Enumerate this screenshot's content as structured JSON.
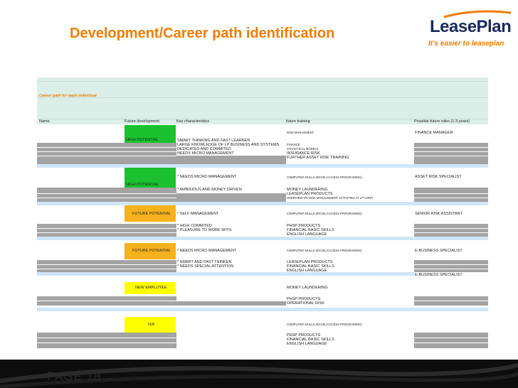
{
  "header": {
    "title": "Development/Career path identification",
    "logo_text": "LeasePlan",
    "tagline": "It's easier to leaseplan"
  },
  "table": {
    "section_title": "Career path for each individual",
    "columns": [
      "Name",
      "Future development",
      "Key characteristics",
      "future training",
      "Possible future roles (1-3 years)"
    ],
    "groups": [
      {
        "status": "HIGH POTENTIAL",
        "status_color": "#19c22e",
        "characteristics": [
          "SMART THINKING AND FAST LEARNER",
          "LARGE KNOWLEDGE OF LP BUSINESS AND SYSTEMS",
          "DEDICATED AND COMMITED",
          "NEEDS MICRO MANAGEMENT"
        ],
        "training": [
          "RISK MANAGMENT",
          "FINANCE",
          "STATISTICAL MODELS",
          "INSURANCE RISK",
          "FURTHER ASSET RISK TRAINING"
        ],
        "roles": [
          "FINANCE MANAGER"
        ]
      },
      {
        "status": "HIGH POTENCIAL",
        "status_color": "#19c22e",
        "characteristics": [
          "* NEEDS MICRO MANAGEMENT",
          "* AMBISIOUS AND MONEY DRIVEN"
        ],
        "training": [
          "COMPUTER SKILLS (EXCEL/ACCESS PROGRAMING)",
          "MONEY LAUNDERING",
          "LEASEPLAN  PRODUCTS",
          "OVERVIEW ON RISK MANAGEMENT ACTIVITIES AT LP CORP"
        ],
        "roles": [
          "ASSET RISK SPECIALIST"
        ]
      },
      {
        "status": "FUTURE POTENTIAL",
        "status_color": "#f5b21c",
        "characteristics": [
          "* SELF MANAGEMENT",
          "* HIGH COMMITED",
          "* PLEASURE TO WORK WITH"
        ],
        "training": [
          "COMPUTER SKILLS (EXCEL/ACCESS PROGRAMING)",
          "PHSP PRODUCTS",
          "FINANCIAL BASIC SKILLS",
          "ENGLISH LANGUAGE"
        ],
        "roles": [
          "SENIOR RISK ASSISTANT"
        ]
      },
      {
        "status": "FUTURE POTENTIAL",
        "status_color": "#f5b21c",
        "characteristics": [
          "* NEEDS MICRO MANAGEMENT",
          "* SMART AND FAST THINKEN",
          "* NEEDS SPECIAL ATTENTION"
        ],
        "training": [
          "COMPUTER SKILLS (EXCEL/ACCESS PROGRAMING)",
          "LEASEPLAN  PRODUCTS",
          "FINANCIAL BASIC SKILLS",
          "ENGLISH LANGUAGE"
        ],
        "roles": [
          "E-BUSINESS SPECIALIST",
          "E-BUSINESS SPECIALIST"
        ]
      },
      {
        "status": "NEW EMPLOYEE",
        "status_color": "#ffff00",
        "characteristics": [],
        "training": [
          "MONEY LAUNDERING",
          "PHSP PRODUCTS",
          "OPERATIONAL RISK"
        ],
        "roles": []
      },
      {
        "status": "N/A",
        "status_color": "#ffff00",
        "characteristics": [],
        "training": [
          "COMPUTER SKILLS (EXCEL/ACCESS PROGRAMING)",
          "PHSP PRODUCTS",
          "FINANCIAL BASIC SKILLS",
          "ENGLISH LANGUAGE"
        ],
        "roles": []
      }
    ]
  },
  "footer": {
    "page_label": "PAGE 18"
  },
  "colors": {
    "title_orange": "#f07c00",
    "logo_navy": "#1a2a5e",
    "header_band": "#dbeee8",
    "grey_row": "#a3a3a3",
    "blue_row": "#cfe6f8",
    "green": "#19c22e",
    "orange": "#f5b21c",
    "yellow": "#ffff00"
  }
}
